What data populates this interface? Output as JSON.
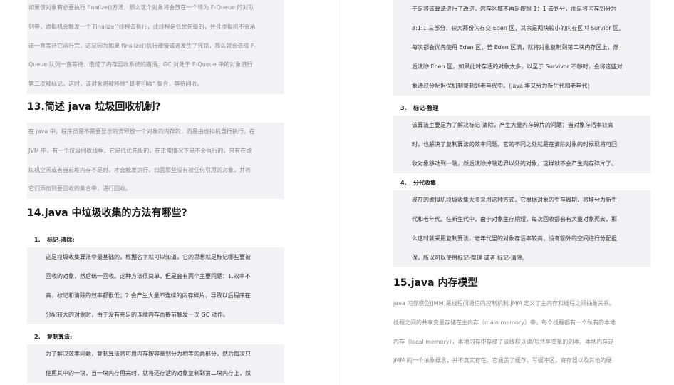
{
  "left": {
    "intro_lines": [
      "如果该对象有必要执行 finalize()方法，那么这个对象将会放在一个称为 F-Queue 的对队",
      "列中，虚拟机会触发一个 Finalize()线程去执行，此线程是低优先级的，并且虚拟机不会承",
      "诺一直等待它运行完，这是因为如果 finalize()执行缓慢或者发生了死锁，那么就会造成 F-",
      "Queue 队列一直等待，造成了内存回收系统的崩溃。GC 对处于 F-Queue 中的对象进行",
      "第二次被标记，这时，该对象将被移除\" 即将回收\" 集合，等待回收。"
    ],
    "h13": "13.简述 java 垃圾回收机制?",
    "h13_lines": [
      "在 java 中，程序员是不需要显示的去释放一个对象的内存的，而是由虚拟机自行执行。在",
      "JVM 中，有一个垃圾回收线程，它是低优先级的，在正常情况下是不会执行的，只有在虚",
      "拟机空闲或者当前堆内存不足时，才会触发执行，扫面那些没有被任何引用的对象，并将",
      "它们添加到要回收的集合中，进行回收。"
    ],
    "h14": "14.java 中垃圾收集的方法有哪些?",
    "item1_num": "1.",
    "item1_title": "标记-清除:",
    "item1_lines": [
      "这是垃圾收集算法中最基础的，根据名字就可以知道，它的思想就是标记哪些要被",
      "回收的对象，然后统一回收。这种方法很简单，但是会有两个主要问题：1.效率不",
      "高，标记和清除的效率都很低；2.会产生大量不连续的内存碎片，导致以后程序在",
      "分配较大的对象时，由于没有充足的连续内存而提前触发一次 GC 动作。"
    ],
    "item2_num": "2.",
    "item2_title": "复制算法:",
    "item2_lines": [
      "为了解决效率问题，复制算法将可用内存按容量划分为相等的两部分，然后每次只",
      "使用其中的一块，当一块内存用完时，就将还存活的对象复制到第二块内存上，然"
    ]
  },
  "right": {
    "cont_lines": [
      "于是将该算法进行了改进，内存区域不再是按照 1：1 去划分，而是将内存划分为",
      "8:1:1 三部分，较大那份内存交 Eden 区，其余是两块较小的内存区叫 Survior 区。",
      "每次都会优先使用 Eden 区，若 Eden 区满，就将对象复制到第二块内存区上，然",
      "后清除 Eden 区，如果此时存活的对象太多，以至于 Survivor 不够时，会将这些对",
      "象通过分配担保机制复制到老年代中。(java 堆又分为新生代和老年代)"
    ],
    "item3_num": "3.",
    "item3_title": "标记-整理",
    "item3_lines": [
      "该算法主要是为了解决标记-清除，产生大量内存碎片的问题；当对象存活率较高",
      "时，也解决了复制算法的效率问题。它的不同之处就是在清除对象的时候现将可回",
      "收对象移动到一端，然后清除掉端边界以外的对象，这样就不会产生内存碎片了。"
    ],
    "item4_num": "4.",
    "item4_title": "分代收集",
    "item4_lines": [
      "现在的虚拟机垃圾收集大多采用这种方式，它根据对象的生存周期，将堆分为新生",
      "代和老年代。在新生代中，由于对象生存期短，每次回收都会有大量对象死去，那",
      "么这时就采用复制算法。老年代里的对象存活率较高，没有额外的空间进行分配担",
      "保，所以可以使用标记-整理 或者 标记-清除。"
    ],
    "h15": "15.java 内存模型",
    "h15_lines": [
      "java 内存模型(JMM)是线程间通信的控制机制.JMM 定义了主内存和线程之间抽象关系。",
      "线程之间的共享变量存储在主内存（main memory）中，每个线程都有一个私有的本地",
      "内存（local memory），本地内存中存储了该线程以读/写共享变量的副本。本地内存是",
      "JMM 的一个抽象概念，并不真实存在。它涵盖了缓存，写缓冲区，寄存器以及其他的硬"
    ]
  }
}
